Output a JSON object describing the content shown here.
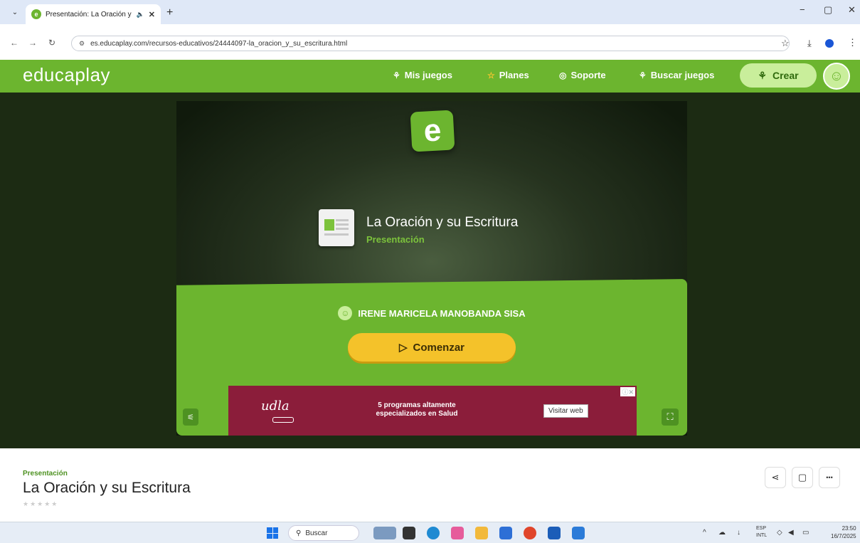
{
  "browser": {
    "tab_title": "Presentación: La Oración y s",
    "tab_audio_icon": "speaker-icon",
    "tab_close": "✕",
    "new_tab": "+",
    "url": "es.educaplay.com/recursos-educativos/24444097-la_oracion_y_su_escritura.html",
    "minimize": "−",
    "restore": "▢",
    "close": "✕"
  },
  "header": {
    "logo": "educaplay",
    "nav": [
      {
        "label": "Mis juegos",
        "icon": "puzzle-icon"
      },
      {
        "label": "Planes",
        "icon": "star-icon"
      },
      {
        "label": "Soporte",
        "icon": "lifebuoy-icon"
      },
      {
        "label": "Buscar juegos",
        "icon": "search-puzzle-icon"
      }
    ],
    "create_label": "Crear",
    "brand_color": "#6cb52f"
  },
  "game": {
    "logo_letter": "e",
    "title": "La Oración y su Escritura",
    "type": "Presentación",
    "author": "IRENE MARICELA MANOBANDA SISA",
    "start_label": "Comenzar"
  },
  "ad": {
    "logo_text": "udla",
    "text": "5 programas altamente especializados en Salud",
    "button": "Visitar web",
    "close": "ⓘ✕"
  },
  "meta": {
    "type": "Presentación",
    "title": "La Oración y su Escritura",
    "stars": "★★★★★"
  },
  "taskbar": {
    "search": "Buscar",
    "lang1": "ESP",
    "lang2": "INTL",
    "time": "23:50",
    "date": "16/7/2025"
  }
}
